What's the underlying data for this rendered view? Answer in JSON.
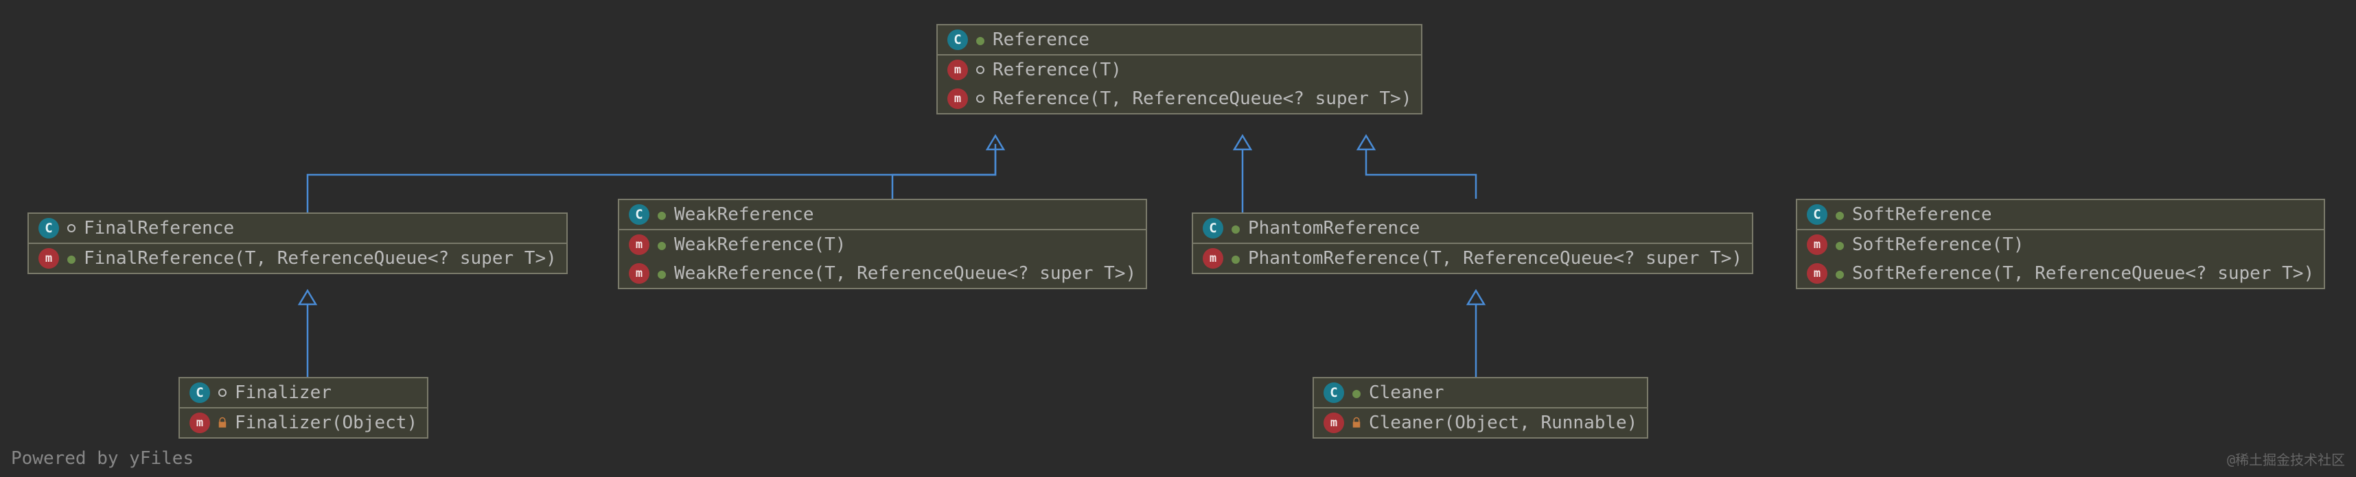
{
  "footer": "Powered by yFiles",
  "watermark": "@稀土掘金技术社区",
  "colors": {
    "bg": "#2b2b2b",
    "box": "#3e3f34",
    "border": "#7a7a6a",
    "edge": "#4a8cd6"
  },
  "classes": {
    "reference": {
      "name": "Reference",
      "vis": "pkg",
      "members": [
        {
          "vis": "circle",
          "sig": "Reference(T)"
        },
        {
          "vis": "circle",
          "sig": "Reference(T, ReferenceQueue<? super T>)"
        }
      ]
    },
    "finalReference": {
      "name": "FinalReference",
      "vis": "circle",
      "members": [
        {
          "vis": "pkg",
          "sig": "FinalReference(T, ReferenceQueue<? super T>)"
        }
      ]
    },
    "weakReference": {
      "name": "WeakReference",
      "vis": "pkg",
      "members": [
        {
          "vis": "pkg",
          "sig": "WeakReference(T)"
        },
        {
          "vis": "pkg",
          "sig": "WeakReference(T, ReferenceQueue<? super T>)"
        }
      ]
    },
    "phantomReference": {
      "name": "PhantomReference",
      "vis": "pkg",
      "members": [
        {
          "vis": "pkg",
          "sig": "PhantomReference(T, ReferenceQueue<? super T>)"
        }
      ]
    },
    "softReference": {
      "name": "SoftReference",
      "vis": "pkg",
      "members": [
        {
          "vis": "pkg",
          "sig": "SoftReference(T)"
        },
        {
          "vis": "pkg",
          "sig": "SoftReference(T, ReferenceQueue<? super T>)"
        }
      ]
    },
    "finalizer": {
      "name": "Finalizer",
      "vis": "circle",
      "members": [
        {
          "vis": "lock",
          "sig": "Finalizer(Object)"
        }
      ]
    },
    "cleaner": {
      "name": "Cleaner",
      "vis": "pkg",
      "members": [
        {
          "vis": "lock",
          "sig": "Cleaner(Object, Runnable)"
        }
      ]
    }
  }
}
